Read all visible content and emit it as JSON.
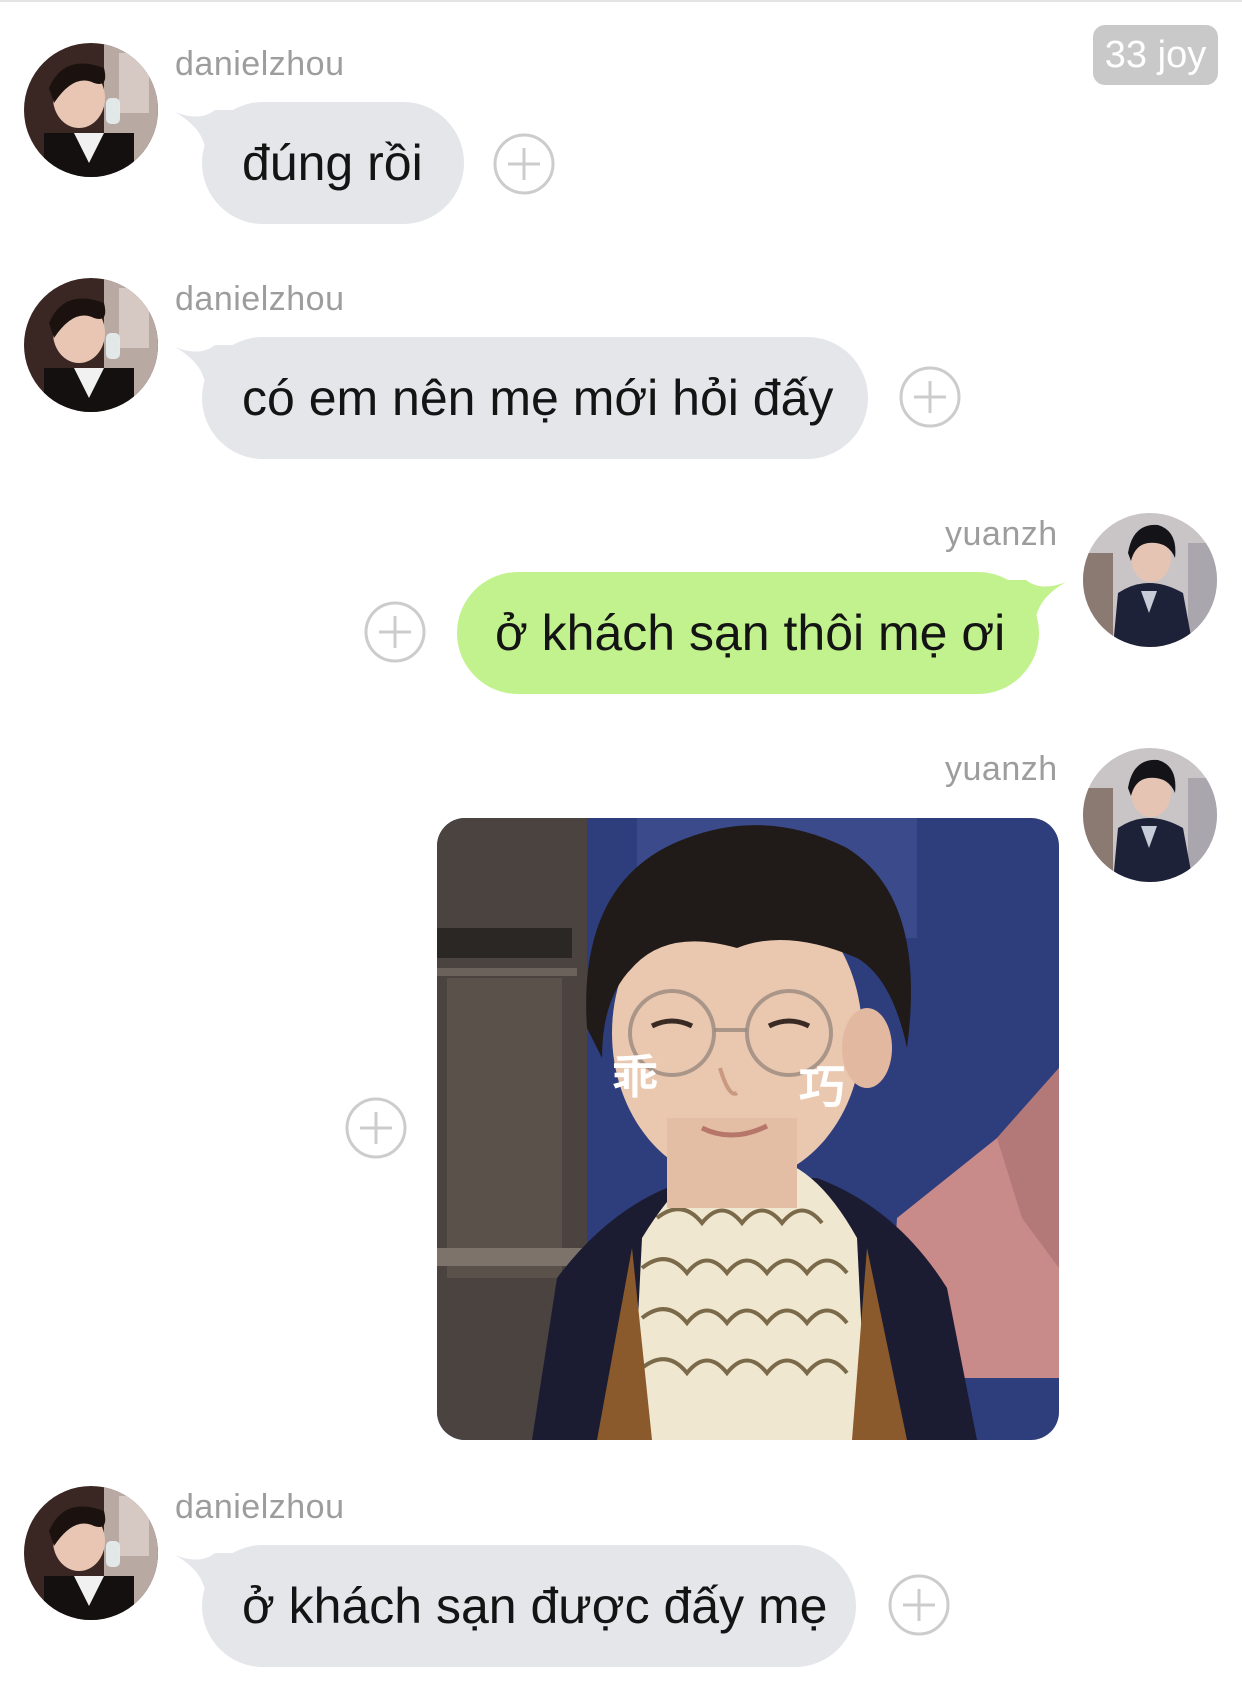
{
  "badge": "33 joy",
  "messages": [
    {
      "user": "danielzhou",
      "text": "đúng rồi"
    },
    {
      "user": "danielzhou",
      "text": "có em nên mẹ mới hỏi đấy"
    },
    {
      "user": "yuanzh",
      "text": "ở khách sạn thôi mẹ ơi"
    },
    {
      "user": "yuanzh",
      "sticker_text_left": "乖",
      "sticker_text_right": "巧"
    },
    {
      "user": "danielzhou",
      "text": "ở khách sạn được đấy mẹ"
    }
  ],
  "colors": {
    "incoming_bubble": "#e4e6ea",
    "outgoing_bubble": "#c2f28d",
    "username": "#9d9d9d",
    "badge_bg": "#c9c9c9"
  }
}
